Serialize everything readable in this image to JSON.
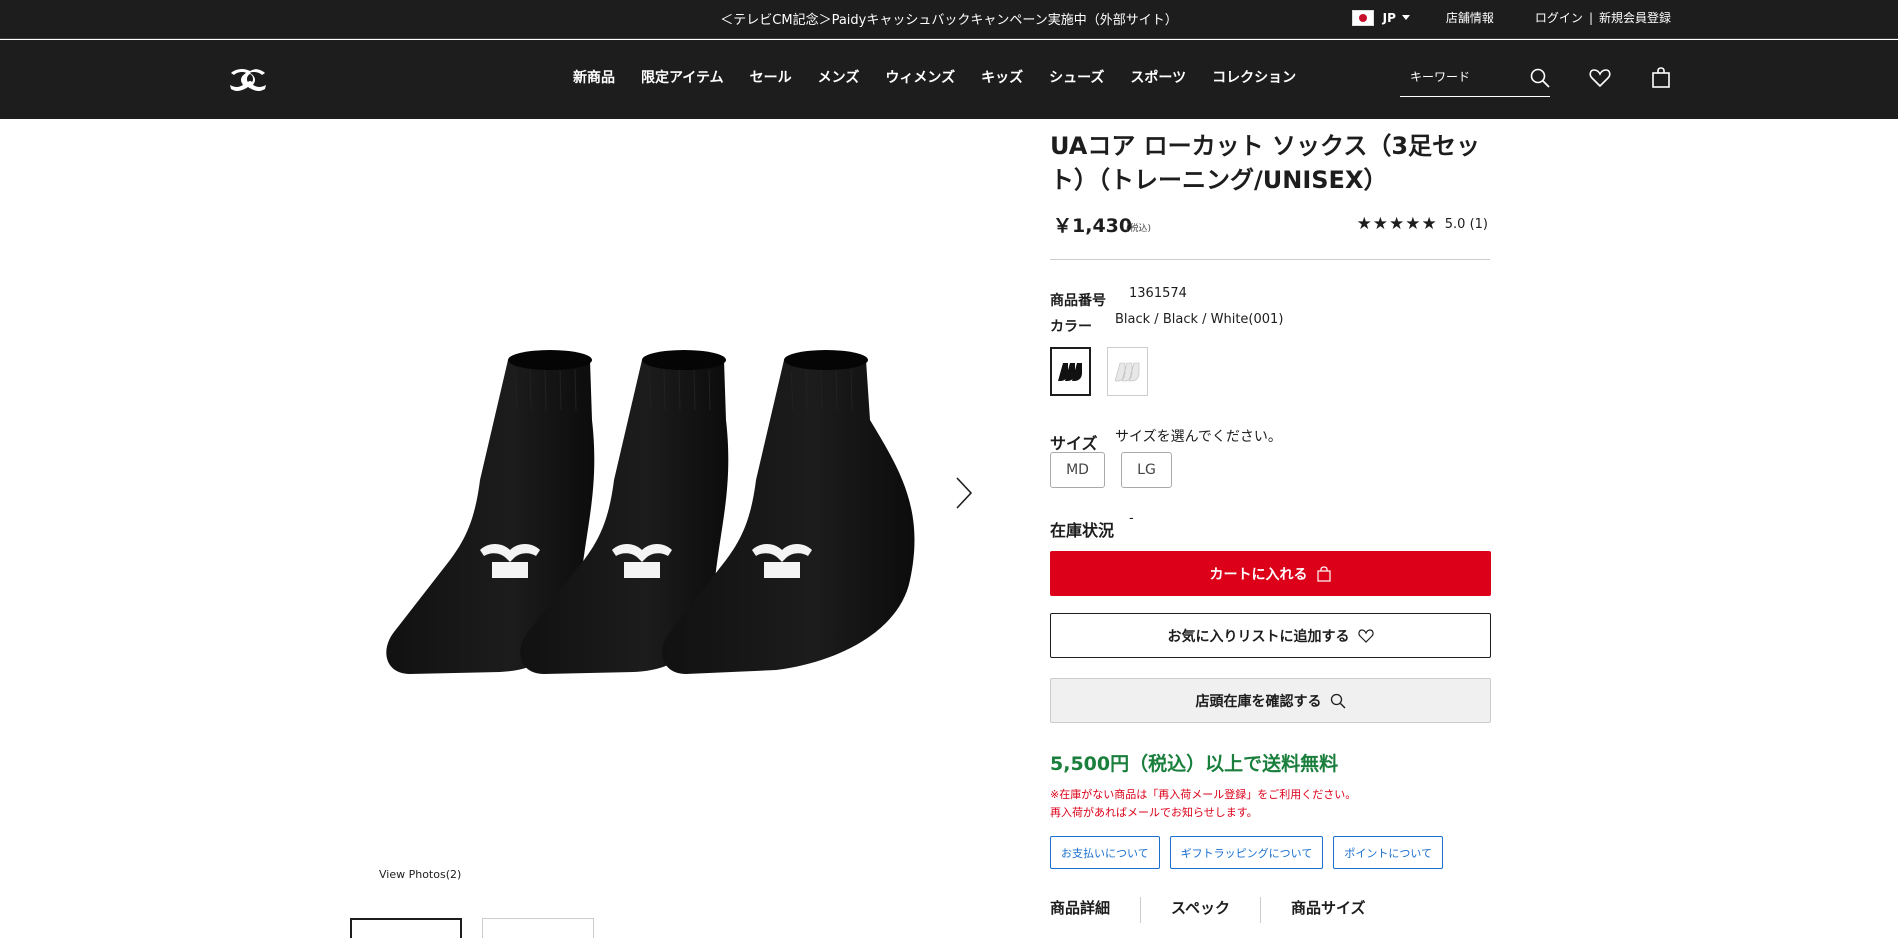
{
  "promo": {
    "text": "＜テレビCM記念＞Paidyキャッシュバックキャンペーン実施中（外部サイト）"
  },
  "utility": {
    "lang": "JP",
    "store_info": "店舗情報",
    "login": "ログイン",
    "separator": "|",
    "register": "新規会員登録"
  },
  "nav": {
    "items": [
      "新商品",
      "限定アイテム",
      "セール",
      "メンズ",
      "ウィメンズ",
      "キッズ",
      "シューズ",
      "スポーツ",
      "コレクション"
    ]
  },
  "search": {
    "placeholder": "キーワード"
  },
  "gallery": {
    "view_photos": "View Photos(2)"
  },
  "product": {
    "title": "UAコア ローカット ソックス（3足セット）（トレーニング/UNISEX）",
    "price": "￥1,430",
    "tax_note": "(税込)",
    "stars": "★★★★★",
    "rating": "5.0 (1)",
    "number_label": "商品番号",
    "number_value": "1361574",
    "color_label": "カラー",
    "color_value": "Black / Black / White(001)",
    "size_label": "サイズ",
    "size_prompt": "サイズを選んでください。",
    "sizes": [
      "MD",
      "LG"
    ],
    "stock_label": "在庫状況",
    "stock_value": "-",
    "cart_button": "カートに入れる",
    "favorite_button": "お気に入りリストに追加する",
    "store_stock_button": "店頭在庫を確認する",
    "free_shipping": "5,500円（税込）以上で送料無料",
    "notice_line1": "※在庫がない商品は「再入荷メール登録」をご利用ください。",
    "notice_line2": "再入荷があればメールでお知らせします。",
    "info_links": [
      "お支払いについて",
      "ギフトラッピングについて",
      "ポイントについて"
    ],
    "tabs": [
      "商品詳細",
      "スペック",
      "商品サイズ"
    ]
  },
  "colors": {
    "header_bg": "#1d1d1d",
    "cart_red": "#dc0019",
    "free_ship_green": "#1a7f3c",
    "link_blue": "#1a6fcf"
  }
}
